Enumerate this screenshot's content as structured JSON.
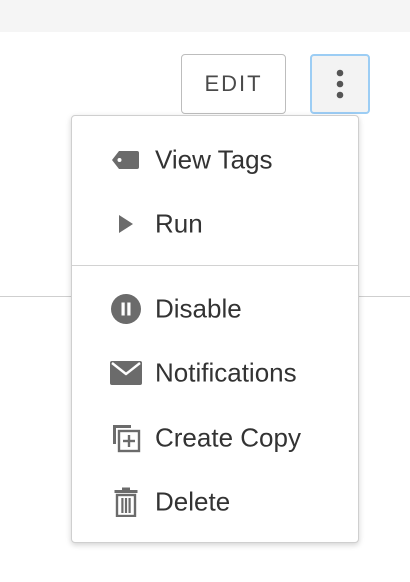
{
  "toolbar": {
    "edit_label": "EDIT",
    "more_button_icon": "vertical-ellipsis-icon",
    "focus_color": "#9ccdf4"
  },
  "menu": {
    "sections": [
      {
        "items": [
          {
            "label": "View Tags",
            "icon": "tag-icon"
          },
          {
            "label": "Run",
            "icon": "play-icon"
          }
        ]
      },
      {
        "items": [
          {
            "label": "Disable",
            "icon": "pause-circle-icon"
          },
          {
            "label": "Notifications",
            "icon": "envelope-icon"
          },
          {
            "label": "Create Copy",
            "icon": "copy-icon"
          },
          {
            "label": "Delete",
            "icon": "trash-icon"
          }
        ]
      }
    ]
  },
  "colors": {
    "icon": "#6b6b6b",
    "text": "#333333"
  }
}
